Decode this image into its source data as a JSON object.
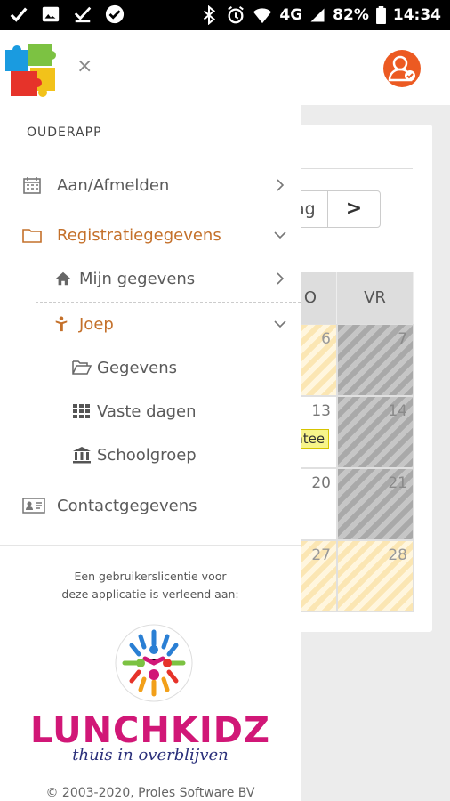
{
  "statusbar": {
    "network": "4G",
    "battery": "82%",
    "time": "14:34",
    "icons": [
      "check-icon",
      "image-icon",
      "download-done-icon",
      "check-circle-icon",
      "bluetooth-icon",
      "alarm-icon",
      "wifi-icon",
      "signal-icon",
      "battery-icon"
    ]
  },
  "header": {
    "close_symbol": "×",
    "user_icon": "user-verified-icon"
  },
  "drawer": {
    "section_title": "OUDERAPP",
    "items": [
      {
        "label": "Aan/Afmelden",
        "icon": "calendar-icon",
        "chevron": "right"
      },
      {
        "label": "Registratiegegevens",
        "icon": "folder-icon",
        "chevron": "down"
      },
      {
        "label": "Mijn gegevens",
        "icon": "home-icon",
        "chevron": "right"
      },
      {
        "label": "Joep",
        "icon": "child-icon",
        "chevron": "down"
      },
      {
        "label": "Gegevens",
        "icon": "folder-open-icon"
      },
      {
        "label": "Vaste dagen",
        "icon": "grid-icon"
      },
      {
        "label": "Schoolgroep",
        "icon": "building-icon"
      },
      {
        "label": "Contactgegevens",
        "icon": "contact-card-icon"
      }
    ],
    "license_line1": "Een gebruikerslicentie voor",
    "license_line2": "deze applicatie is verleend aan:",
    "lunchkidz_name": "LUNCHKIDZ",
    "lunchkidz_tagline": "thuis in overblijven",
    "copyright": "© 2003-2020, Proles Software BV"
  },
  "background": {
    "prev_button": "ag",
    "next_button": ">",
    "day_headers": [
      "O",
      "VR"
    ],
    "day_numbers": [
      "6",
      "7",
      "13",
      "14",
      "20",
      "21",
      "27",
      "28"
    ],
    "tag_text": "entee",
    "colors": {
      "accent": "#c4702a",
      "avatar": "#ec5a22",
      "brand": "#d11777"
    }
  }
}
